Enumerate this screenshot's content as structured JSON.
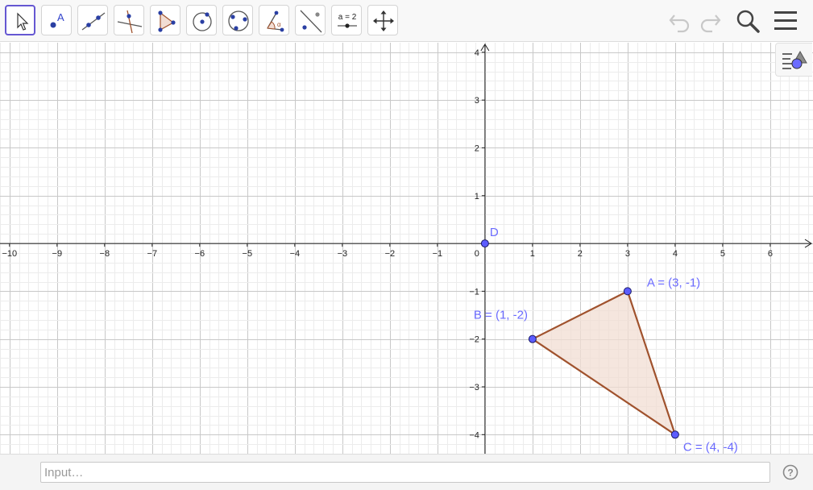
{
  "toolbar": {
    "tools": [
      {
        "name": "move-tool",
        "selected": true
      },
      {
        "name": "point-tool"
      },
      {
        "name": "line-tool"
      },
      {
        "name": "perpendicular-line-tool"
      },
      {
        "name": "polygon-tool"
      },
      {
        "name": "circle-center-point-tool"
      },
      {
        "name": "circle-three-points-tool"
      },
      {
        "name": "angle-tool"
      },
      {
        "name": "reflect-about-line-tool"
      },
      {
        "name": "slider-tool",
        "label": "a = 2"
      },
      {
        "name": "move-graphics-view-tool"
      }
    ],
    "right_icons": [
      "undo-icon",
      "redo-icon",
      "search-icon",
      "menu-icon"
    ]
  },
  "graphics": {
    "x_ticks": [
      "−10",
      "−9",
      "−8",
      "−7",
      "−6",
      "−5",
      "−4",
      "−3",
      "−2",
      "−1",
      "0",
      "1",
      "2",
      "3",
      "4",
      "5",
      "6"
    ],
    "y_ticks": [
      "4",
      "3",
      "2",
      "1",
      "−1",
      "−2",
      "−3",
      "−4"
    ],
    "xlim": [
      -10.2,
      6.9
    ],
    "ylim": [
      -4.4,
      4.2
    ],
    "grid": true,
    "points": [
      {
        "id": "D",
        "label": "D",
        "x": 0,
        "y": 0
      },
      {
        "id": "A",
        "label": "A = (3, -1)",
        "x": 3,
        "y": -1
      },
      {
        "id": "B",
        "label": "B = (1, -2)",
        "x": 1,
        "y": -2
      },
      {
        "id": "C",
        "label": "C = (4, -4)",
        "x": 4,
        "y": -4
      }
    ],
    "polygon": {
      "vertices": [
        "A",
        "B",
        "C"
      ],
      "stroke": "#a0522d",
      "fill": "#f2ddd3"
    },
    "point_color": "#5c5cff"
  },
  "input_bar": {
    "placeholder": "Input…"
  },
  "help_label": "?"
}
